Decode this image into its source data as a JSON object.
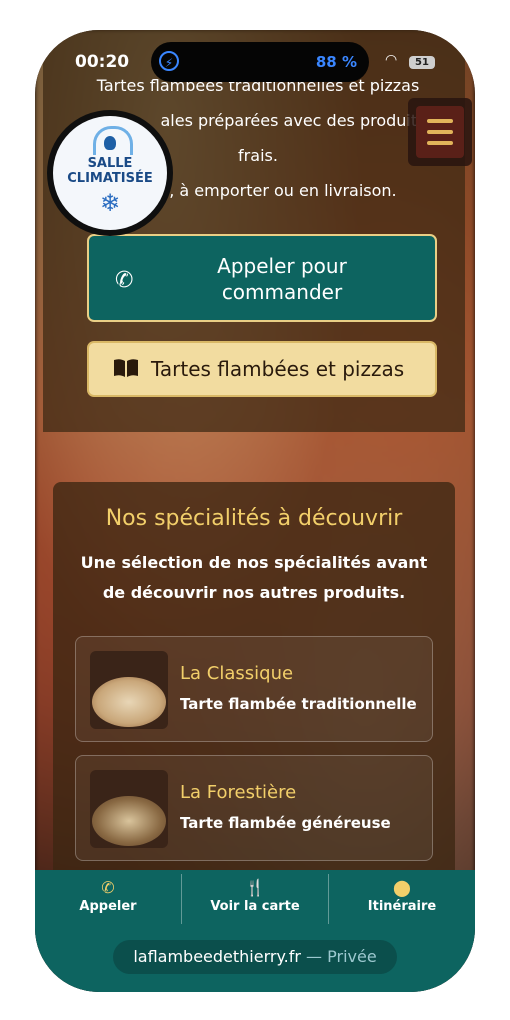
{
  "status_bar": {
    "time": "00:20",
    "battery_percent": "88 %",
    "battery_level": "51"
  },
  "hero": {
    "tagline_lines": [
      "Tartes flambées traditionnelles et pizzas",
      "ales préparées avec des produits",
      "frais.",
      "e, à emporter ou en livraison."
    ],
    "badge_line1": "SALLE",
    "badge_line2": "CLIMATISÉE",
    "call_button": "Appeler pour commander",
    "menu_button": "Tartes flambées et pizzas"
  },
  "specialties": {
    "title": "Nos spécialités à découvrir",
    "subtitle": "Une sélection de nos spécialités avant de découvrir nos autres produits.",
    "items": [
      {
        "name": "La Classique",
        "description": "Tarte flambée traditionnelle"
      },
      {
        "name": "La Forestière",
        "description": "Tarte flambée généreuse"
      }
    ]
  },
  "bottom_nav": [
    {
      "label": "Appeler",
      "icon": "phone-icon"
    },
    {
      "label": "Voir la carte",
      "icon": "fork-knife-icon"
    },
    {
      "label": "Itinéraire",
      "icon": "map-pin-icon"
    }
  ],
  "browser": {
    "host": "laflambeedethierry.fr",
    "private": "— Privée"
  },
  "colors": {
    "teal": "#0d6460",
    "gold": "#f2cf6a",
    "cream": "#f2dca0"
  }
}
